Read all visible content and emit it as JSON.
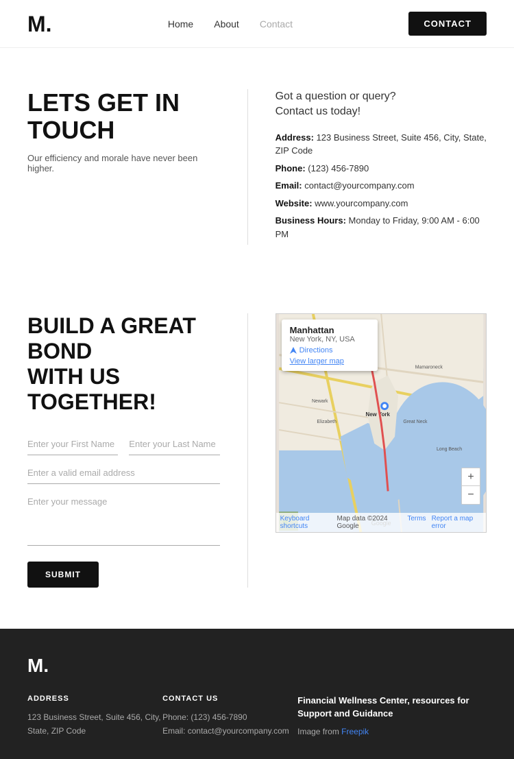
{
  "navbar": {
    "logo": "M.",
    "links": [
      {
        "label": "Home",
        "href": "#",
        "active": false
      },
      {
        "label": "About",
        "href": "#",
        "active": false
      },
      {
        "label": "Contact",
        "href": "#",
        "active": true
      }
    ],
    "contact_button": "CONTACT"
  },
  "hero": {
    "title": "LETS GET IN TOUCH",
    "subtitle": "Our efficiency and morale have never been higher.",
    "question_line1": "Got a question or query?",
    "question_line2": "Contact us today!",
    "address_label": "Address:",
    "address_value": "123 Business Street, Suite 456, City, State, ZIP Code",
    "phone_label": "Phone:",
    "phone_value": "(123) 456-7890",
    "email_label": "Email:",
    "email_value": "contact@yourcompany.com",
    "website_label": "Website:",
    "website_value": "www.yourcompany.com",
    "hours_label": "Business Hours:",
    "hours_value": "Monday to Friday, 9:00 AM - 6:00 PM"
  },
  "form": {
    "title_line1": "BUILD A GREAT BOND",
    "title_line2": "WITH US TOGETHER!",
    "firstname_placeholder": "Enter your First Name",
    "lastname_placeholder": "Enter your Last Name",
    "email_placeholder": "Enter a valid email address",
    "message_placeholder": "Enter your message",
    "submit_label": "SUBMIT"
  },
  "map": {
    "place_name": "Manhattan",
    "place_sub": "New York, NY, USA",
    "directions_label": "Directions",
    "view_larger": "View larger map",
    "zoom_in": "+",
    "zoom_out": "−",
    "footer_keyboard": "Keyboard shortcuts",
    "footer_map_data": "Map data ©2024 Google",
    "footer_terms": "Terms",
    "footer_report": "Report a map error"
  },
  "footer": {
    "logo": "M.",
    "address_col_title": "ADDRESS",
    "address_line": "123 Business Street, Suite 456, City, State, ZIP Code",
    "contact_col_title": "CONTACT US",
    "contact_phone": "Phone: (123) 456-7890",
    "contact_email": "Email: contact@yourcompany.com",
    "wellness_title": "Financial Wellness Center, resources for Support and Guidance",
    "image_from": "Image from ",
    "freepik_label": "Freepik"
  }
}
